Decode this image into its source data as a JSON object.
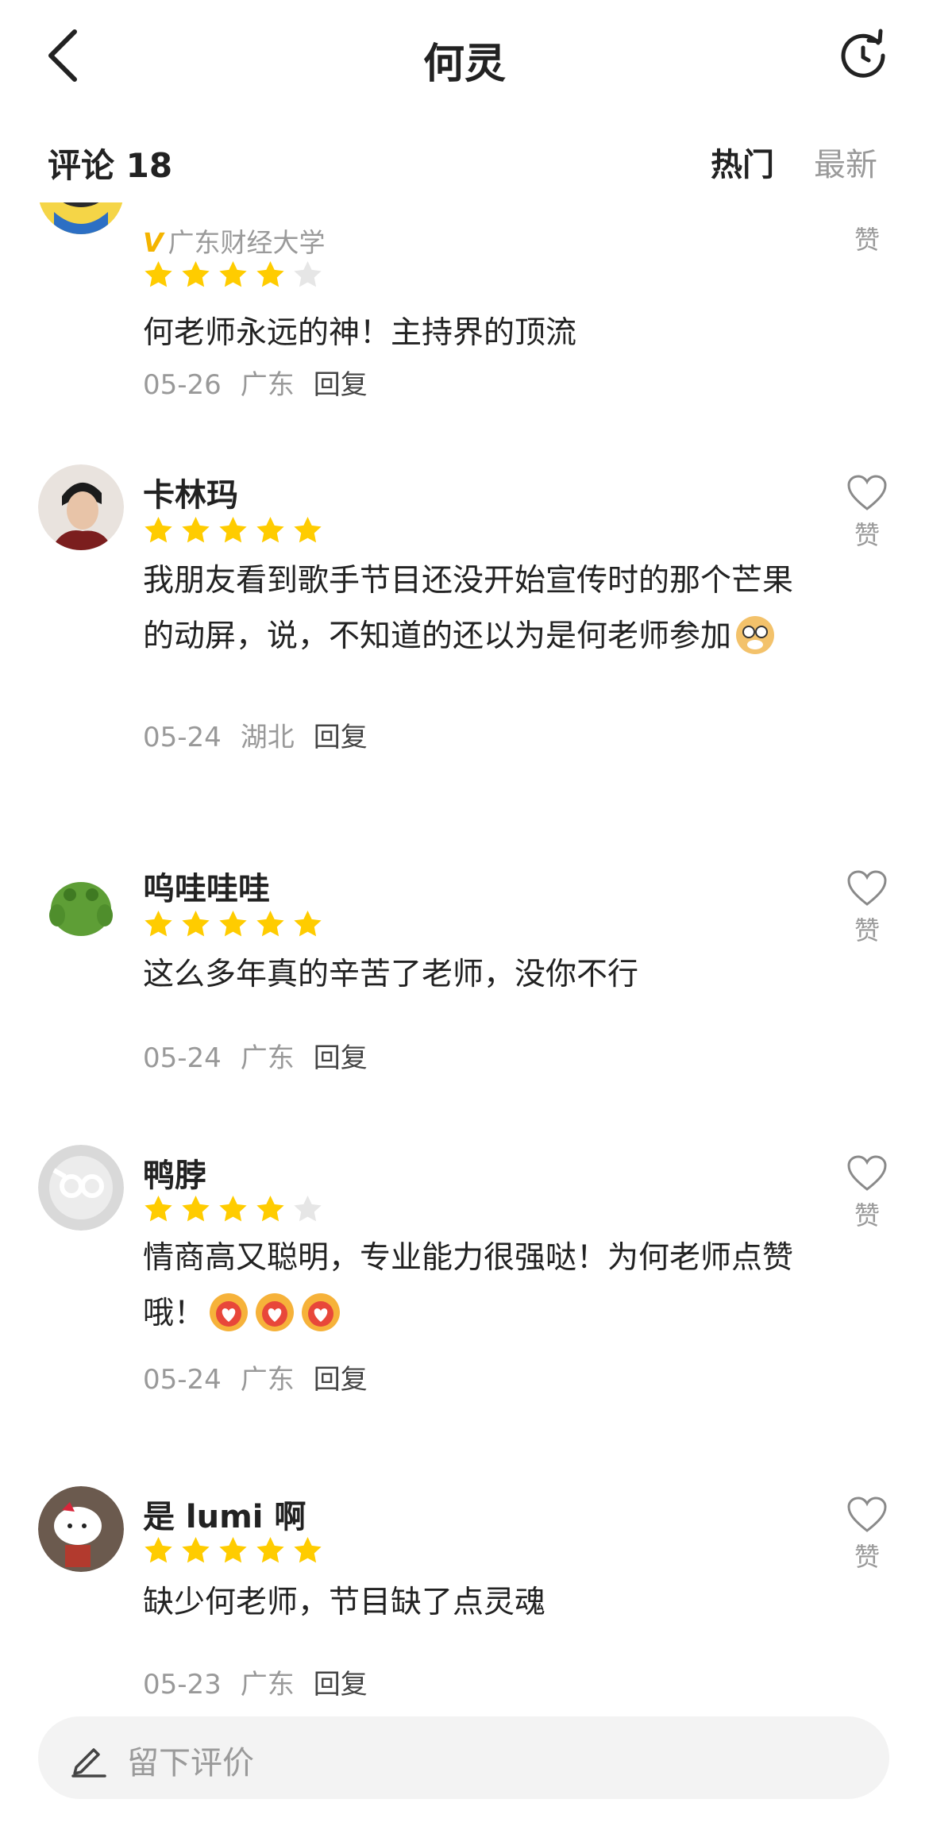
{
  "nav": {
    "title": "何灵",
    "back_icon": "chevron-left-icon",
    "refresh_icon": "refresh-icon"
  },
  "filter": {
    "count_label": "评论 18",
    "hot_label": "热门",
    "new_label": "最新"
  },
  "like_label": "赞",
  "comments": [
    {
      "name": "",
      "school": "广东财经大学",
      "verified": "V",
      "rating": 4,
      "text": "何老师永远的神！主持界的顶流",
      "date": "05-26",
      "location": "广东",
      "reply": "回复"
    },
    {
      "name": "卡林玛",
      "rating": 5,
      "text": "我朋友看到歌手节目还没开始宣传时的那个芒果的动屏，说，不知道的还以为是何老师参加",
      "date": "05-24",
      "location": "湖北",
      "reply": "回复"
    },
    {
      "name": "呜哇哇哇",
      "rating": 5,
      "text": "这么多年真的辛苦了老师，没你不行",
      "date": "05-24",
      "location": "广东",
      "reply": "回复"
    },
    {
      "name": "鸭脖",
      "rating": 4,
      "text": "情商高又聪明，专业能力很强哒！为何老师点赞哦！",
      "date": "05-24",
      "location": "广东",
      "reply": "回复"
    },
    {
      "name": "是 lumi 啊",
      "rating": 5,
      "text": "缺少何老师，节目缺了点灵魂",
      "date": "05-23",
      "location": "广东",
      "reply": "回复"
    }
  ],
  "input": {
    "placeholder": "留下评价",
    "icon": "pen-icon"
  },
  "colors": {
    "star": "#ffcc00",
    "star_empty": "#e6e6e6",
    "text": "#222222",
    "muted": "#9a9a9a",
    "verified": "#f4b400"
  }
}
